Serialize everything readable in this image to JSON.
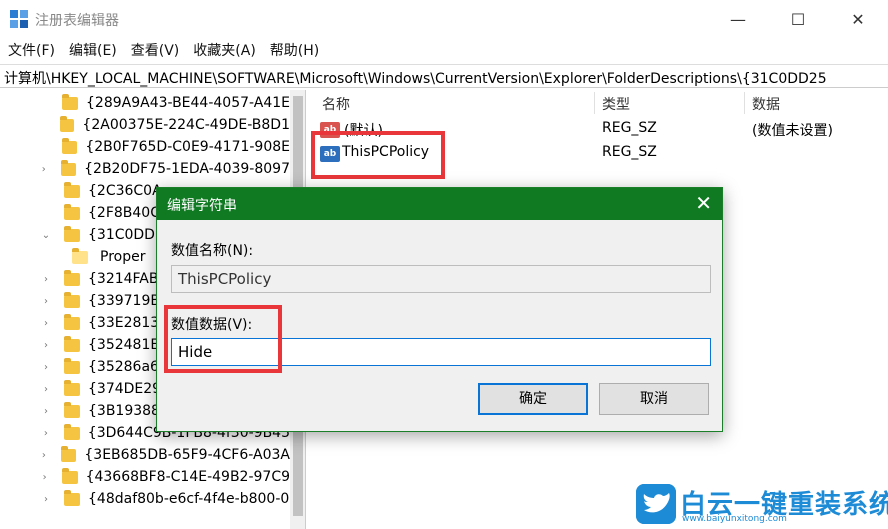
{
  "window": {
    "title": "注册表编辑器",
    "minimize": "—",
    "maximize": "☐",
    "close": "✕"
  },
  "menu": [
    "文件(F)",
    "编辑(E)",
    "查看(V)",
    "收藏夹(A)",
    "帮助(H)"
  ],
  "address": "计算机\\HKEY_LOCAL_MACHINE\\SOFTWARE\\Microsoft\\Windows\\CurrentVersion\\Explorer\\FolderDescriptions\\{31C0DD25",
  "tree": [
    {
      "label": "{289A9A43-BE44-4057-A41E",
      "arrow": ""
    },
    {
      "label": "{2A00375E-224C-49DE-B8D1",
      "arrow": ""
    },
    {
      "label": "{2B0F765D-C0E9-4171-908E",
      "arrow": ""
    },
    {
      "label": "{2B20DF75-1EDA-4039-8097",
      "arrow": "›"
    },
    {
      "label": "{2C36C0A",
      "arrow": ""
    },
    {
      "label": "{2F8B40C2",
      "arrow": ""
    },
    {
      "label": "{31C0DD2",
      "arrow": "⌄"
    },
    {
      "label": "Proper",
      "arrow": ""
    },
    {
      "label": "{3214FAB5",
      "arrow": "›"
    },
    {
      "label": "{339719B5",
      "arrow": "›"
    },
    {
      "label": "{33E2813C",
      "arrow": "›"
    },
    {
      "label": "{352481E8",
      "arrow": "›"
    },
    {
      "label": "{35286a68",
      "arrow": "›"
    },
    {
      "label": "{374DE290",
      "arrow": "›"
    },
    {
      "label": "{3B193882",
      "arrow": "›"
    },
    {
      "label": "{3D644C9B-1FB8-4f30-9B45",
      "arrow": "›"
    },
    {
      "label": "{3EB685DB-65F9-4CF6-A03A",
      "arrow": "›"
    },
    {
      "label": "{43668BF8-C14E-49B2-97C9",
      "arrow": "›"
    },
    {
      "label": "{48daf80b-e6cf-4f4e-b800-0",
      "arrow": "›"
    }
  ],
  "list": {
    "columns": [
      "名称",
      "类型",
      "数据"
    ],
    "rows": [
      {
        "icon": "ab",
        "name": "(默认)",
        "type": "REG_SZ",
        "data": "(数值未设置)"
      },
      {
        "icon": "ab",
        "name": "ThisPCPolicy",
        "type": "REG_SZ",
        "data": ""
      }
    ]
  },
  "dialog": {
    "title": "编辑字符串",
    "close": "✕",
    "name_label": "数值名称(N):",
    "name_value": "ThisPCPolicy",
    "data_label": "数值数据(V):",
    "data_value": "Hide",
    "ok": "确定",
    "cancel": "取消"
  },
  "watermark": {
    "text": "白云一键重装系统",
    "url": "www.baiyunxitong.com"
  },
  "colors": {
    "dialog_title": "#0f7a22",
    "highlight": "#e8363a",
    "focus": "#0a74d6",
    "brand": "#1d8bd6"
  }
}
